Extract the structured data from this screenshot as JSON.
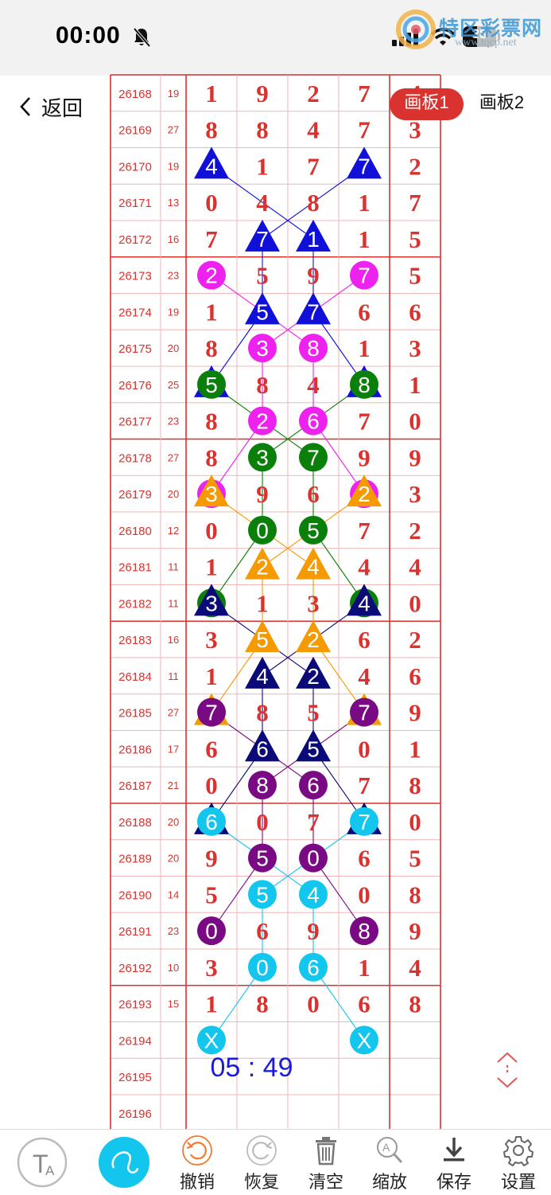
{
  "status": {
    "time": "00:00",
    "battery": "38",
    "watermark_title": "特区彩票网",
    "watermark_url": "www.tqcp.net"
  },
  "nav": {
    "back_label": "返回",
    "tabs": [
      "画板1",
      "画板2"
    ]
  },
  "rows": [
    {
      "issue": "26168",
      "sum": "19",
      "d": [
        "1",
        "9",
        "2",
        "7"
      ],
      "extra": "4"
    },
    {
      "issue": "26169",
      "sum": "27",
      "d": [
        "8",
        "8",
        "4",
        "7"
      ],
      "extra": "3"
    },
    {
      "issue": "26170",
      "sum": "19",
      "d": [
        "4",
        "1",
        "7",
        "7"
      ],
      "extra": "2"
    },
    {
      "issue": "26171",
      "sum": "13",
      "d": [
        "0",
        "4",
        "8",
        "1"
      ],
      "extra": "7"
    },
    {
      "issue": "26172",
      "sum": "16",
      "d": [
        "7",
        "7",
        "1",
        "1"
      ],
      "extra": "5"
    },
    {
      "issue": "26173",
      "sum": "23",
      "d": [
        "2",
        "5",
        "9",
        "7"
      ],
      "extra": "5"
    },
    {
      "issue": "26174",
      "sum": "19",
      "d": [
        "1",
        "5",
        "7",
        "6"
      ],
      "extra": "6"
    },
    {
      "issue": "26175",
      "sum": "20",
      "d": [
        "8",
        "3",
        "8",
        "1"
      ],
      "extra": "3"
    },
    {
      "issue": "26176",
      "sum": "25",
      "d": [
        "5",
        "8",
        "4",
        "8"
      ],
      "extra": "1"
    },
    {
      "issue": "26177",
      "sum": "23",
      "d": [
        "8",
        "2",
        "6",
        "7"
      ],
      "extra": "0"
    },
    {
      "issue": "26178",
      "sum": "27",
      "d": [
        "8",
        "3",
        "7",
        "9"
      ],
      "extra": "9"
    },
    {
      "issue": "26179",
      "sum": "20",
      "d": [
        "3",
        "9",
        "6",
        "2"
      ],
      "extra": "3"
    },
    {
      "issue": "26180",
      "sum": "12",
      "d": [
        "0",
        "0",
        "5",
        "7"
      ],
      "extra": "2"
    },
    {
      "issue": "26181",
      "sum": "11",
      "d": [
        "1",
        "2",
        "4",
        "4"
      ],
      "extra": "4"
    },
    {
      "issue": "26182",
      "sum": "11",
      "d": [
        "3",
        "1",
        "3",
        "4"
      ],
      "extra": "0"
    },
    {
      "issue": "26183",
      "sum": "16",
      "d": [
        "3",
        "5",
        "2",
        "6"
      ],
      "extra": "2"
    },
    {
      "issue": "26184",
      "sum": "11",
      "d": [
        "1",
        "4",
        "2",
        "4"
      ],
      "extra": "6"
    },
    {
      "issue": "26185",
      "sum": "27",
      "d": [
        "7",
        "8",
        "5",
        "7"
      ],
      "extra": "9"
    },
    {
      "issue": "26186",
      "sum": "17",
      "d": [
        "6",
        "6",
        "5",
        "0"
      ],
      "extra": "1"
    },
    {
      "issue": "26187",
      "sum": "21",
      "d": [
        "0",
        "8",
        "6",
        "7"
      ],
      "extra": "8"
    },
    {
      "issue": "26188",
      "sum": "20",
      "d": [
        "6",
        "0",
        "7",
        "7"
      ],
      "extra": "0"
    },
    {
      "issue": "26189",
      "sum": "20",
      "d": [
        "9",
        "5",
        "0",
        "6"
      ],
      "extra": "5"
    },
    {
      "issue": "26190",
      "sum": "14",
      "d": [
        "5",
        "5",
        "4",
        "0"
      ],
      "extra": "8"
    },
    {
      "issue": "26191",
      "sum": "23",
      "d": [
        "0",
        "6",
        "9",
        "8"
      ],
      "extra": "9"
    },
    {
      "issue": "26192",
      "sum": "10",
      "d": [
        "3",
        "0",
        "6",
        "1"
      ],
      "extra": "4"
    },
    {
      "issue": "26193",
      "sum": "15",
      "d": [
        "1",
        "8",
        "0",
        "6"
      ],
      "extra": "8"
    },
    {
      "issue": "26194",
      "sum": "",
      "d": [
        "",
        "",
        "",
        ""
      ],
      "extra": ""
    },
    {
      "issue": "26195",
      "sum": "",
      "d": [
        "",
        "",
        "",
        ""
      ],
      "extra": ""
    },
    {
      "issue": "26196",
      "sum": "",
      "d": [
        "",
        "",
        "",
        ""
      ],
      "extra": ""
    }
  ],
  "markers": [
    {
      "row": 2,
      "col": 0,
      "shape": "tri",
      "color": "#1010d8",
      "label": "4"
    },
    {
      "row": 2,
      "col": 3,
      "shape": "tri",
      "color": "#1010d8",
      "label": "7"
    },
    {
      "row": 4,
      "col": 1,
      "shape": "tri",
      "color": "#1010d8",
      "label": "7"
    },
    {
      "row": 4,
      "col": 2,
      "shape": "tri",
      "color": "#1010d8",
      "label": "1"
    },
    {
      "row": 5,
      "col": 0,
      "shape": "circle",
      "color": "#ee22ee",
      "label": "2"
    },
    {
      "row": 5,
      "col": 3,
      "shape": "circle",
      "color": "#ee22ee",
      "label": "7"
    },
    {
      "row": 6,
      "col": 1,
      "shape": "tri",
      "color": "#1010d8",
      "label": "5"
    },
    {
      "row": 6,
      "col": 2,
      "shape": "tri",
      "color": "#1010d8",
      "label": "7"
    },
    {
      "row": 7,
      "col": 1,
      "shape": "circle",
      "color": "#ee22ee",
      "label": "3"
    },
    {
      "row": 7,
      "col": 2,
      "shape": "circle",
      "color": "#ee22ee",
      "label": "8"
    },
    {
      "row": 8,
      "col": 0,
      "shape": "tri",
      "color": "#1010d8",
      "label": ""
    },
    {
      "row": 8,
      "col": 3,
      "shape": "tri",
      "color": "#1010d8",
      "label": ""
    },
    {
      "row": 8,
      "col": 0,
      "shape": "circle",
      "color": "#0a7f0a",
      "label": "5"
    },
    {
      "row": 8,
      "col": 3,
      "shape": "circle",
      "color": "#0a7f0a",
      "label": "8"
    },
    {
      "row": 9,
      "col": 1,
      "shape": "circle",
      "color": "#ee22ee",
      "label": "2"
    },
    {
      "row": 9,
      "col": 2,
      "shape": "circle",
      "color": "#ee22ee",
      "label": "6"
    },
    {
      "row": 10,
      "col": 1,
      "shape": "circle",
      "color": "#0a7f0a",
      "label": "3"
    },
    {
      "row": 10,
      "col": 2,
      "shape": "circle",
      "color": "#0a7f0a",
      "label": "7"
    },
    {
      "row": 11,
      "col": 0,
      "shape": "circle",
      "color": "#ee22ee",
      "label": ""
    },
    {
      "row": 11,
      "col": 3,
      "shape": "circle",
      "color": "#ee22ee",
      "label": ""
    },
    {
      "row": 11,
      "col": 0,
      "shape": "tri",
      "color": "#f59a00",
      "label": "3"
    },
    {
      "row": 11,
      "col": 3,
      "shape": "tri",
      "color": "#f59a00",
      "label": "2"
    },
    {
      "row": 12,
      "col": 1,
      "shape": "circle",
      "color": "#0a7f0a",
      "label": "0"
    },
    {
      "row": 12,
      "col": 2,
      "shape": "circle",
      "color": "#0a7f0a",
      "label": "5"
    },
    {
      "row": 13,
      "col": 1,
      "shape": "tri",
      "color": "#f59a00",
      "label": "2"
    },
    {
      "row": 13,
      "col": 2,
      "shape": "tri",
      "color": "#f59a00",
      "label": "4"
    },
    {
      "row": 14,
      "col": 0,
      "shape": "circle",
      "color": "#0a7f0a",
      "label": ""
    },
    {
      "row": 14,
      "col": 3,
      "shape": "circle",
      "color": "#0a7f0a",
      "label": ""
    },
    {
      "row": 14,
      "col": 0,
      "shape": "tri",
      "color": "#0a0a78",
      "label": "3"
    },
    {
      "row": 14,
      "col": 3,
      "shape": "tri",
      "color": "#0a0a78",
      "label": "4"
    },
    {
      "row": 15,
      "col": 1,
      "shape": "tri",
      "color": "#f59a00",
      "label": "5"
    },
    {
      "row": 15,
      "col": 2,
      "shape": "tri",
      "color": "#f59a00",
      "label": "2"
    },
    {
      "row": 16,
      "col": 1,
      "shape": "tri",
      "color": "#0a0a78",
      "label": "4"
    },
    {
      "row": 16,
      "col": 2,
      "shape": "tri",
      "color": "#0a0a78",
      "label": "2"
    },
    {
      "row": 17,
      "col": 0,
      "shape": "tri",
      "color": "#f59a00",
      "label": ""
    },
    {
      "row": 17,
      "col": 3,
      "shape": "tri",
      "color": "#f59a00",
      "label": ""
    },
    {
      "row": 17,
      "col": 0,
      "shape": "circle",
      "color": "#7a0a84",
      "label": "7"
    },
    {
      "row": 17,
      "col": 3,
      "shape": "circle",
      "color": "#7a0a84",
      "label": "7"
    },
    {
      "row": 18,
      "col": 1,
      "shape": "tri",
      "color": "#0a0a78",
      "label": "6"
    },
    {
      "row": 18,
      "col": 2,
      "shape": "tri",
      "color": "#0a0a78",
      "label": "5"
    },
    {
      "row": 19,
      "col": 1,
      "shape": "circle",
      "color": "#7a0a84",
      "label": "8"
    },
    {
      "row": 19,
      "col": 2,
      "shape": "circle",
      "color": "#7a0a84",
      "label": "6"
    },
    {
      "row": 20,
      "col": 0,
      "shape": "tri",
      "color": "#0a0a78",
      "label": ""
    },
    {
      "row": 20,
      "col": 3,
      "shape": "tri",
      "color": "#0a0a78",
      "label": ""
    },
    {
      "row": 20,
      "col": 0,
      "shape": "circle",
      "color": "#12c6ee",
      "label": "6"
    },
    {
      "row": 20,
      "col": 3,
      "shape": "circle",
      "color": "#12c6ee",
      "label": "7"
    },
    {
      "row": 21,
      "col": 1,
      "shape": "circle",
      "color": "#7a0a84",
      "label": "5"
    },
    {
      "row": 21,
      "col": 2,
      "shape": "circle",
      "color": "#7a0a84",
      "label": "0"
    },
    {
      "row": 22,
      "col": 1,
      "shape": "circle",
      "color": "#12c6ee",
      "label": "5"
    },
    {
      "row": 22,
      "col": 2,
      "shape": "circle",
      "color": "#12c6ee",
      "label": "4"
    },
    {
      "row": 23,
      "col": 0,
      "shape": "circle",
      "color": "#7a0a84",
      "label": "0"
    },
    {
      "row": 23,
      "col": 3,
      "shape": "circle",
      "color": "#7a0a84",
      "label": "8"
    },
    {
      "row": 24,
      "col": 1,
      "shape": "circle",
      "color": "#12c6ee",
      "label": "0"
    },
    {
      "row": 24,
      "col": 2,
      "shape": "circle",
      "color": "#12c6ee",
      "label": "6"
    },
    {
      "row": 26,
      "col": 0,
      "shape": "circle",
      "color": "#12c6ee",
      "label": "X"
    },
    {
      "row": 26,
      "col": 3,
      "shape": "circle",
      "color": "#12c6ee",
      "label": "X"
    }
  ],
  "lines": [
    {
      "color": "#1010d8",
      "from": [
        2,
        0
      ],
      "to": [
        4,
        2
      ]
    },
    {
      "color": "#1010d8",
      "from": [
        2,
        3
      ],
      "to": [
        4,
        1
      ]
    },
    {
      "color": "#1010d8",
      "from": [
        4,
        1
      ],
      "to": [
        6,
        1
      ]
    },
    {
      "color": "#1010d8",
      "from": [
        4,
        2
      ],
      "to": [
        6,
        2
      ]
    },
    {
      "color": "#1010d8",
      "from": [
        6,
        1
      ],
      "to": [
        8,
        0
      ]
    },
    {
      "color": "#1010d8",
      "from": [
        6,
        2
      ],
      "to": [
        8,
        3
      ]
    },
    {
      "color": "#ee22ee",
      "from": [
        5,
        0
      ],
      "to": [
        7,
        2
      ]
    },
    {
      "color": "#ee22ee",
      "from": [
        5,
        3
      ],
      "to": [
        7,
        1
      ]
    },
    {
      "color": "#ee22ee",
      "from": [
        7,
        1
      ],
      "to": [
        9,
        1
      ]
    },
    {
      "color": "#ee22ee",
      "from": [
        7,
        2
      ],
      "to": [
        9,
        2
      ]
    },
    {
      "color": "#ee22ee",
      "from": [
        9,
        1
      ],
      "to": [
        11,
        0
      ]
    },
    {
      "color": "#ee22ee",
      "from": [
        9,
        2
      ],
      "to": [
        11,
        3
      ]
    },
    {
      "color": "#0a7f0a",
      "from": [
        8,
        0
      ],
      "to": [
        10,
        2
      ]
    },
    {
      "color": "#0a7f0a",
      "from": [
        8,
        3
      ],
      "to": [
        10,
        1
      ]
    },
    {
      "color": "#0a7f0a",
      "from": [
        10,
        1
      ],
      "to": [
        12,
        1
      ]
    },
    {
      "color": "#0a7f0a",
      "from": [
        10,
        2
      ],
      "to": [
        12,
        2
      ]
    },
    {
      "color": "#0a7f0a",
      "from": [
        12,
        1
      ],
      "to": [
        14,
        0
      ]
    },
    {
      "color": "#0a7f0a",
      "from": [
        12,
        2
      ],
      "to": [
        14,
        3
      ]
    },
    {
      "color": "#f59a00",
      "from": [
        11,
        0
      ],
      "to": [
        13,
        2
      ]
    },
    {
      "color": "#f59a00",
      "from": [
        11,
        3
      ],
      "to": [
        13,
        1
      ]
    },
    {
      "color": "#f59a00",
      "from": [
        13,
        1
      ],
      "to": [
        15,
        1
      ]
    },
    {
      "color": "#f59a00",
      "from": [
        13,
        2
      ],
      "to": [
        15,
        2
      ]
    },
    {
      "color": "#f59a00",
      "from": [
        15,
        1
      ],
      "to": [
        17,
        0
      ]
    },
    {
      "color": "#f59a00",
      "from": [
        15,
        2
      ],
      "to": [
        17,
        3
      ]
    },
    {
      "color": "#0a0a78",
      "from": [
        14,
        0
      ],
      "to": [
        16,
        2
      ]
    },
    {
      "color": "#0a0a78",
      "from": [
        14,
        3
      ],
      "to": [
        16,
        1
      ]
    },
    {
      "color": "#0a0a78",
      "from": [
        16,
        1
      ],
      "to": [
        18,
        1
      ]
    },
    {
      "color": "#0a0a78",
      "from": [
        16,
        2
      ],
      "to": [
        18,
        2
      ]
    },
    {
      "color": "#0a0a78",
      "from": [
        18,
        1
      ],
      "to": [
        20,
        0
      ]
    },
    {
      "color": "#0a0a78",
      "from": [
        18,
        2
      ],
      "to": [
        20,
        3
      ]
    },
    {
      "color": "#7a0a84",
      "from": [
        17,
        0
      ],
      "to": [
        19,
        2
      ]
    },
    {
      "color": "#7a0a84",
      "from": [
        17,
        3
      ],
      "to": [
        19,
        1
      ]
    },
    {
      "color": "#7a0a84",
      "from": [
        19,
        1
      ],
      "to": [
        21,
        1
      ]
    },
    {
      "color": "#7a0a84",
      "from": [
        19,
        2
      ],
      "to": [
        21,
        2
      ]
    },
    {
      "color": "#7a0a84",
      "from": [
        21,
        1
      ],
      "to": [
        23,
        0
      ]
    },
    {
      "color": "#7a0a84",
      "from": [
        21,
        2
      ],
      "to": [
        23,
        3
      ]
    },
    {
      "color": "#12c6ee",
      "from": [
        20,
        0
      ],
      "to": [
        22,
        2
      ]
    },
    {
      "color": "#12c6ee",
      "from": [
        20,
        3
      ],
      "to": [
        22,
        1
      ]
    },
    {
      "color": "#12c6ee",
      "from": [
        22,
        1
      ],
      "to": [
        24,
        1
      ]
    },
    {
      "color": "#12c6ee",
      "from": [
        22,
        2
      ],
      "to": [
        24,
        2
      ]
    },
    {
      "color": "#12c6ee",
      "from": [
        24,
        1
      ],
      "to": [
        26,
        0
      ]
    },
    {
      "color": "#12c6ee",
      "from": [
        24,
        2
      ],
      "to": [
        26,
        3
      ]
    }
  ],
  "timer": "05 : 49",
  "toolbar": {
    "undo": "撤销",
    "redo": "恢复",
    "clear": "清空",
    "zoom": "缩放",
    "save": "保存",
    "settings": "设置"
  },
  "colors": {
    "grid_red": "#d9322f",
    "digit_red": "#d9322f",
    "accent_cyan": "#12c6ee",
    "timer_blue": "#1a1ae0"
  }
}
